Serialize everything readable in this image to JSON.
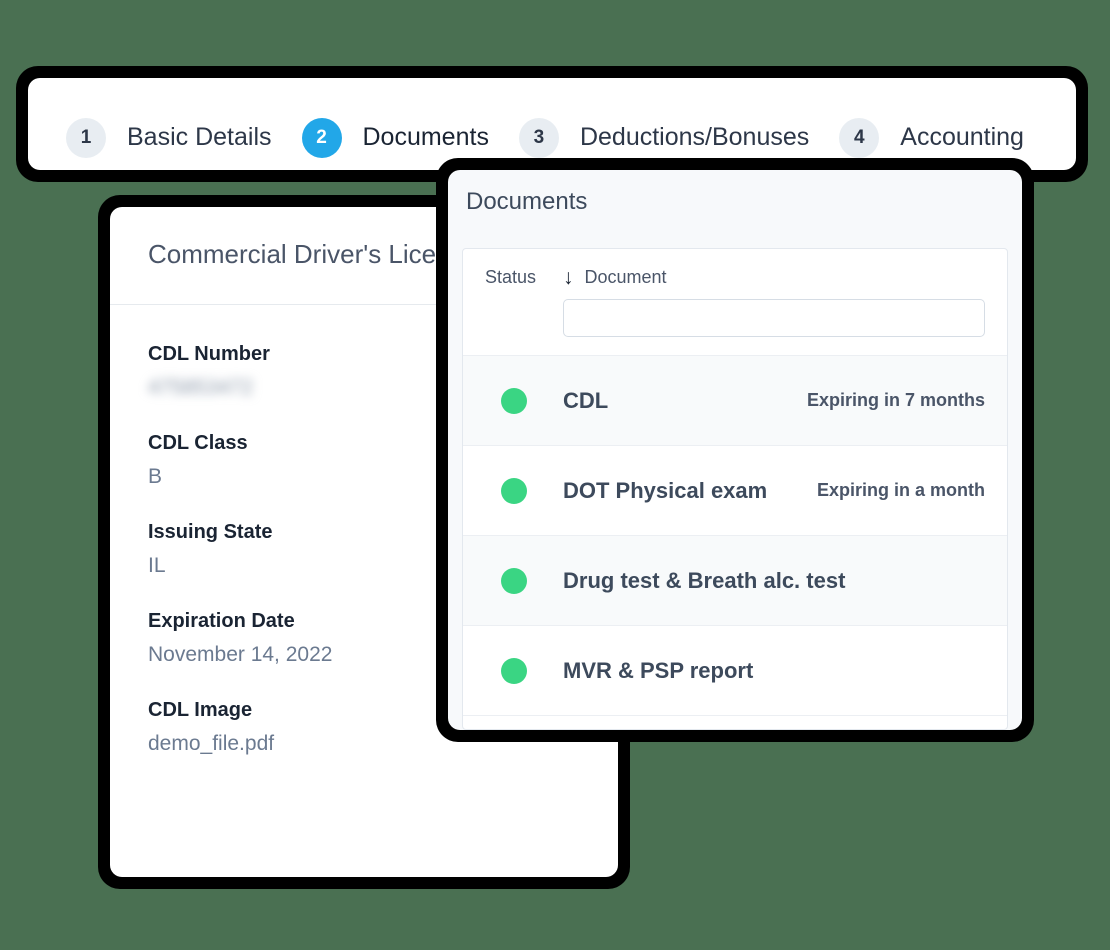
{
  "theme": {
    "background": "#4a7052",
    "frame_border": "#000000",
    "accent_blue": "#22a7e8",
    "status_green": "#3ad583",
    "text_dark": "#1a2433",
    "text_muted": "#6b7a90"
  },
  "tabs": [
    {
      "number": "1",
      "label": "Basic Details",
      "active": false
    },
    {
      "number": "2",
      "label": "Documents",
      "active": true
    },
    {
      "number": "3",
      "label": "Deductions/Bonuses",
      "active": false
    },
    {
      "number": "4",
      "label": "Accounting",
      "active": false
    }
  ],
  "cdl_card": {
    "title": "Commercial Driver's License",
    "fields": [
      {
        "label": "CDL Number",
        "value": "475853472",
        "redacted": true
      },
      {
        "label": "CDL Class",
        "value": "B",
        "redacted": false
      },
      {
        "label": "Issuing State",
        "value": "IL",
        "redacted": false
      },
      {
        "label": "Expiration Date",
        "value": "November 14, 2022",
        "redacted": false
      },
      {
        "label": "CDL Image",
        "value": "demo_file.pdf",
        "redacted": false
      }
    ]
  },
  "documents_card": {
    "title": "Documents",
    "columns": {
      "status": "Status",
      "document": "Document",
      "sort_icon": "arrow-down-icon",
      "sort_glyph": "↓"
    },
    "filter": {
      "value": "",
      "placeholder": ""
    },
    "rows": [
      {
        "status": "ok",
        "name": "CDL",
        "expiry": "Expiring in 7 months"
      },
      {
        "status": "ok",
        "name": "DOT Physical exam",
        "expiry": "Expiring in a month"
      },
      {
        "status": "ok",
        "name": "Drug test & Breath alc. test",
        "expiry": ""
      },
      {
        "status": "ok",
        "name": "MVR & PSP report",
        "expiry": ""
      }
    ]
  }
}
